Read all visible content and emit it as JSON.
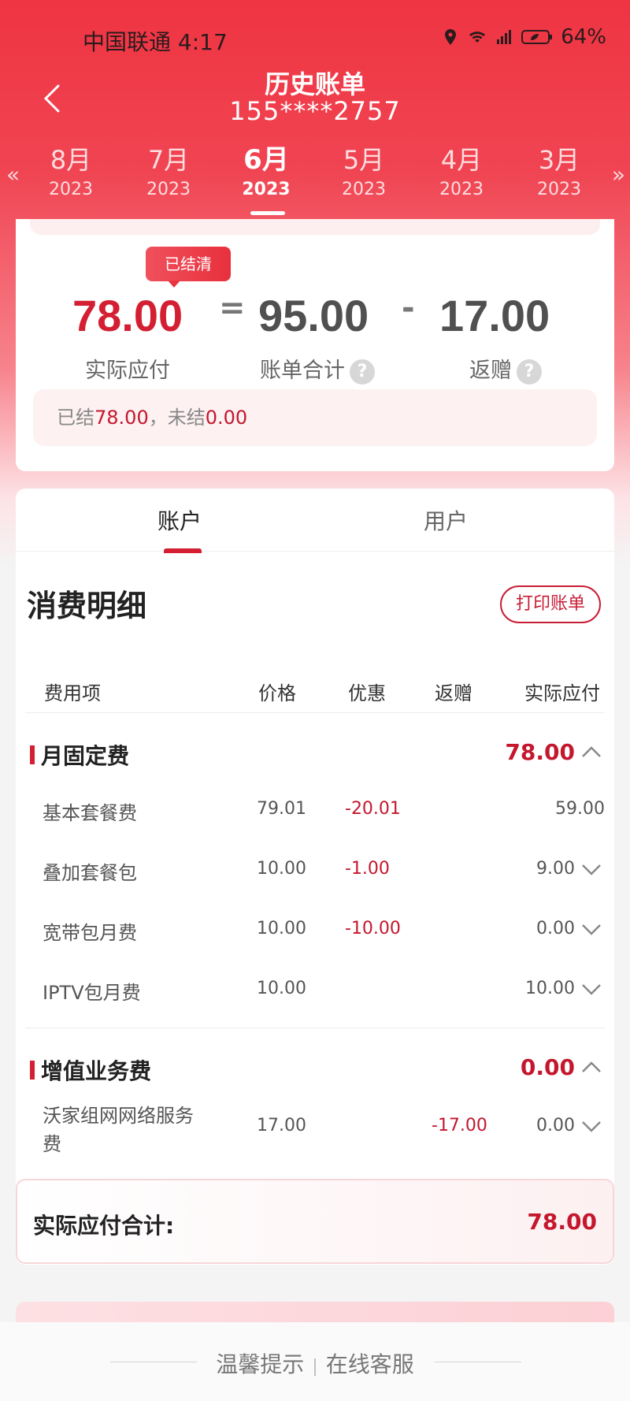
{
  "status_bar": {
    "carrier_time": "中国联通 4:17",
    "battery": "64%"
  },
  "header": {
    "title": "历史账单",
    "phone": "155****2757"
  },
  "months": [
    {
      "month": "8月",
      "year": "2023"
    },
    {
      "month": "7月",
      "year": "2023"
    },
    {
      "month": "6月",
      "year": "2023"
    },
    {
      "month": "5月",
      "year": "2023"
    },
    {
      "month": "4月",
      "year": "2023"
    },
    {
      "month": "3月",
      "year": "2023"
    }
  ],
  "summary": {
    "badge": "已结清",
    "actual": "78.00",
    "actual_label": "实际应付",
    "total": "95.00",
    "total_label": "账单合计",
    "rebate": "17.00",
    "rebate_label": "返赠",
    "settled_prefix": "已结",
    "settled_value": "78.00",
    "unsettled_prefix": "，未结",
    "unsettled_value": "0.00"
  },
  "tabs": {
    "account": "账户",
    "user": "用户"
  },
  "detail": {
    "title": "消费明细",
    "print_label": "打印账单",
    "columns": {
      "item": "费用项",
      "price": "价格",
      "discount": "优惠",
      "rebate": "返赠",
      "actual": "实际应付"
    },
    "groups": [
      {
        "title": "月固定费",
        "amount": "78.00",
        "rows": [
          {
            "name": "基本套餐费",
            "price": "79.01",
            "discount": "-20.01",
            "rebate": "",
            "actual": "59.00"
          },
          {
            "name": "叠加套餐包",
            "price": "10.00",
            "discount": "-1.00",
            "rebate": "",
            "actual": "9.00"
          },
          {
            "name": "宽带包月费",
            "price": "10.00",
            "discount": "-10.00",
            "rebate": "",
            "actual": "0.00"
          },
          {
            "name": "IPTV包月费",
            "price": "10.00",
            "discount": "",
            "rebate": "",
            "actual": "10.00"
          }
        ]
      },
      {
        "title": "增值业务费",
        "amount": "0.00",
        "rows": [
          {
            "name_line1": "沃家组网网络服务",
            "name_line2": "费",
            "price": "17.00",
            "discount": "",
            "rebate": "-17.00",
            "actual": "0.00"
          }
        ]
      }
    ],
    "total_label": "实际应付合计:",
    "total_value": "78.00"
  },
  "footer": {
    "tips": "温馨提示",
    "service": "在线客服"
  }
}
